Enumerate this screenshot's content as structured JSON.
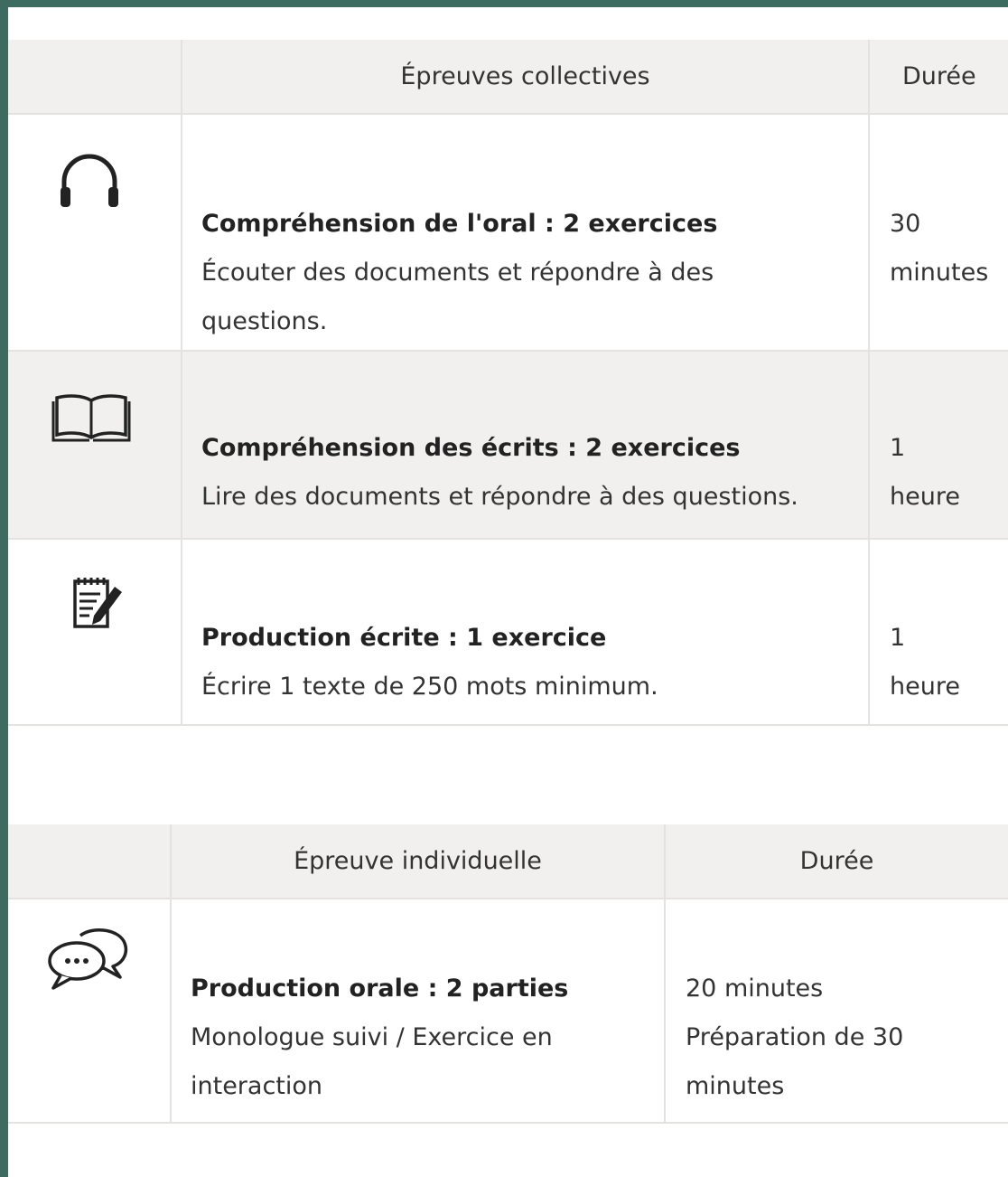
{
  "table1": {
    "header": {
      "col1": "Épreuves collectives",
      "col2": "Durée"
    },
    "rows": [
      {
        "icon": "headphones-icon",
        "title": "Compréhension de l'oral : 2 exercices",
        "desc": "Écouter des documents et répondre à des questions.",
        "dur_line1": "30",
        "dur_line2": "minutes"
      },
      {
        "icon": "open-book-icon",
        "title": "Compréhension des écrits : 2 exercices",
        "desc": "Lire des documents et répondre à des questions.",
        "dur_line1": "1",
        "dur_line2": "heure"
      },
      {
        "icon": "notepad-pencil-icon",
        "title": "Production écrite : 1 exercice",
        "desc": "Écrire 1 texte de 250 mots minimum.",
        "dur_line1": "1",
        "dur_line2": "heure"
      }
    ]
  },
  "table2": {
    "header": {
      "col1": "Épreuve individuelle",
      "col2": "Durée"
    },
    "rows": [
      {
        "icon": "speech-bubbles-icon",
        "title": "Production orale : 2 parties",
        "desc": "Monologue suivi / Exercice en interaction",
        "dur_line1": "20 minutes",
        "dur_line2": "Préparation de 30 minutes"
      }
    ]
  }
}
